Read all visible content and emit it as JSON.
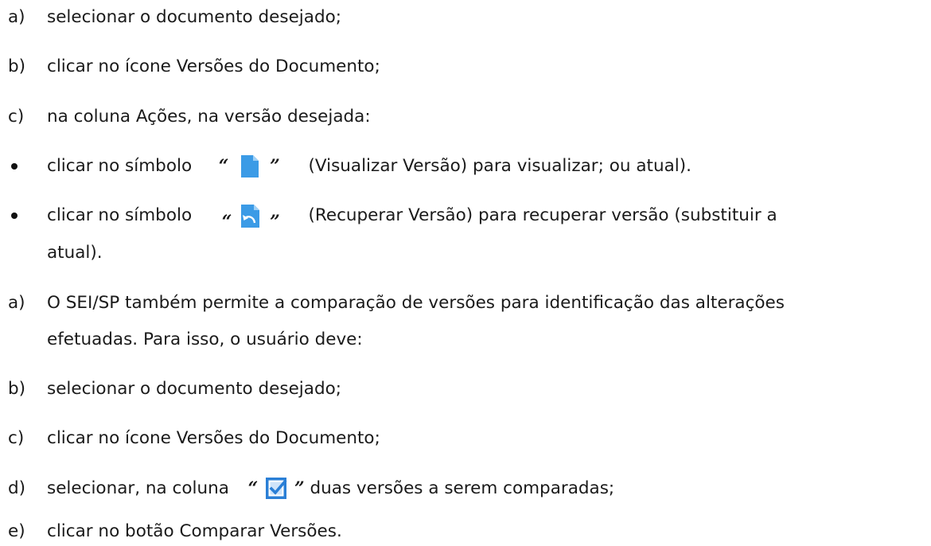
{
  "steps": [
    {
      "marker": "a)",
      "text": "selecionar o documento desejado;"
    },
    {
      "marker": "b)",
      "text": "clicar no ícone Versões do Documento;"
    },
    {
      "marker": "c)",
      "text": "na coluna Ações, na versão desejada:"
    }
  ],
  "bullets": [
    {
      "before": "clicar no símbolo",
      "quote_open": "“",
      "quote_close": "”",
      "icon": "document-icon",
      "after": "(Visualizar Versão) para visualizar; ou atual)."
    },
    {
      "before": "clicar no símbolo",
      "quote_open": "“",
      "quote_close": "”",
      "icon": "document-restore-icon",
      "after": "(Recuperar Versão) para recuperar versão (substituir a",
      "continuation": "atual)."
    }
  ],
  "steps2": [
    {
      "marker": "a)",
      "text": "O SEI/SP também permite a comparação de versões para identificação das alterações",
      "continuation": "efetuadas. Para isso, o usuário deve:"
    },
    {
      "marker": "b)",
      "text": "selecionar o documento desejado;"
    },
    {
      "marker": "c)",
      "text": "clicar no ícone Versões do Documento;"
    },
    {
      "marker": "d)",
      "before": "selecionar, na coluna",
      "quote_open": "“",
      "quote_close": "”",
      "icon": "checkbox-checked-icon",
      "after": "duas versões a serem comparadas;"
    },
    {
      "marker": "e)",
      "text": "clicar no botão Comparar Versões."
    }
  ],
  "colors": {
    "icon_blue": "#3b9be6",
    "icon_blue_dark": "#1f78c8",
    "checkbox_blue": "#2a7fd6"
  }
}
